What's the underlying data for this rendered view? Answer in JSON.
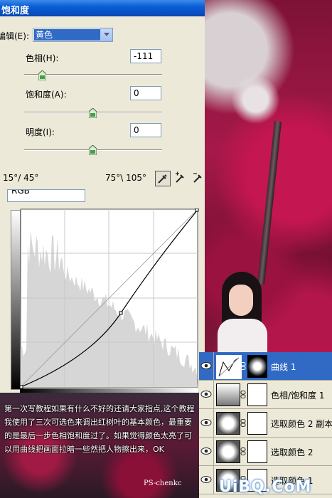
{
  "dialog": {
    "title": "饱和度",
    "edit_label": "编辑(E):",
    "edit_value": "黄色",
    "hue_label": "色相(H):",
    "hue_value": "-111",
    "sat_label": "饱和度(A):",
    "sat_value": "0",
    "light_label": "明度(I):",
    "light_value": "0",
    "range_left": "15°/ 45°",
    "range_right": "75°\\ 105°"
  },
  "curves": {
    "channel": "RGB"
  },
  "layers": [
    {
      "name": "曲线 1",
      "active": true,
      "thumb": "curves-thumbnail",
      "mask": "black-vignette-mask"
    },
    {
      "name": "色相/饱和度 1",
      "active": false,
      "thumb": "hue-saturation-thumbnail",
      "mask": "white-mask"
    },
    {
      "name": "选取颜色 2 副本",
      "active": false,
      "thumb": "selective-color-thumbnail",
      "mask": "white-mask"
    },
    {
      "name": "选取颜色 2",
      "active": false,
      "thumb": "selective-color-thumbnail",
      "mask": "white-mask"
    },
    {
      "name": "选取颜色 1",
      "active": false,
      "thumb": "selective-color-thumbnail",
      "mask": "white-mask"
    }
  ],
  "caption": {
    "text": "第一次写教程如果有什么不好的还请大家指点,这个教程我使用了三次可选色来调出红树叶的基本颜色，最重要的是最后一步色相饱和度过了。如果觉得颜色太亮了可以用曲线把画面拉暗一些然把人物擦出来，OK",
    "signature": "PS-chenkc"
  },
  "watermark": "UiBQ.CoM",
  "colors": {
    "title_bar": "#0a5fd8",
    "selection": "#316ac5",
    "dialog_bg": "#ece9d8",
    "foliage": "#a6194a"
  }
}
